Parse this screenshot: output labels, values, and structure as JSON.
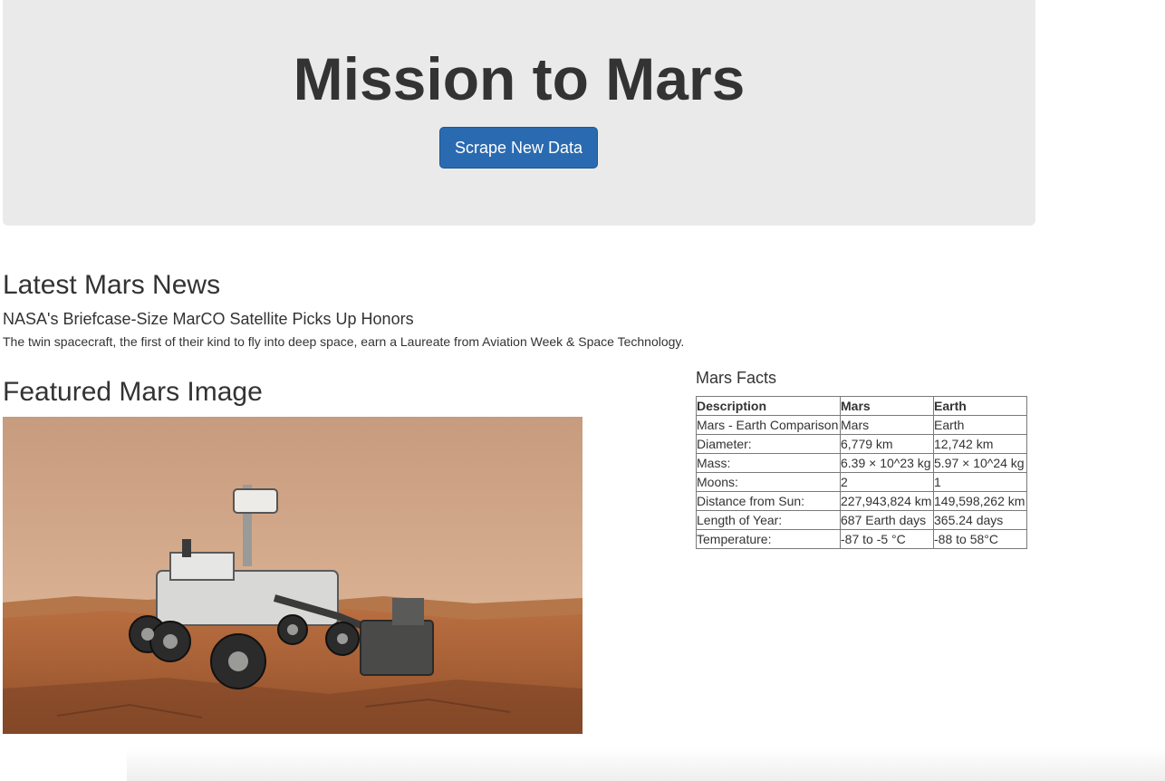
{
  "header": {
    "title": "Mission to Mars",
    "scrape_button_label": "Scrape New Data"
  },
  "news": {
    "heading": "Latest Mars News",
    "title": "NASA's Briefcase-Size MarCO Satellite Picks Up Honors",
    "teaser": "The twin spacecraft, the first of their kind to fly into deep space, earn a Laureate from Aviation Week & Space Technology."
  },
  "featured_image": {
    "heading": "Featured Mars Image",
    "subject": "Mars rover on reddish Martian terrain"
  },
  "facts": {
    "heading": "Mars Facts",
    "columns": [
      "Description",
      "Mars",
      "Earth"
    ],
    "rows": [
      [
        "Mars - Earth Comparison",
        "Mars",
        "Earth"
      ],
      [
        "Diameter:",
        "6,779 km",
        "12,742 km"
      ],
      [
        "Mass:",
        "6.39 × 10^23 kg",
        "5.97 × 10^24 kg"
      ],
      [
        "Moons:",
        "2",
        "1"
      ],
      [
        "Distance from Sun:",
        "227,943,824 km",
        "149,598,262 km"
      ],
      [
        "Length of Year:",
        "687 Earth days",
        "365.24 days"
      ],
      [
        "Temperature:",
        "-87 to -5 °C",
        "-88 to 58°C"
      ]
    ]
  },
  "colors": {
    "jumbotron_bg": "#eaeaea",
    "button_bg": "#2a6ab0",
    "text": "#333333"
  }
}
